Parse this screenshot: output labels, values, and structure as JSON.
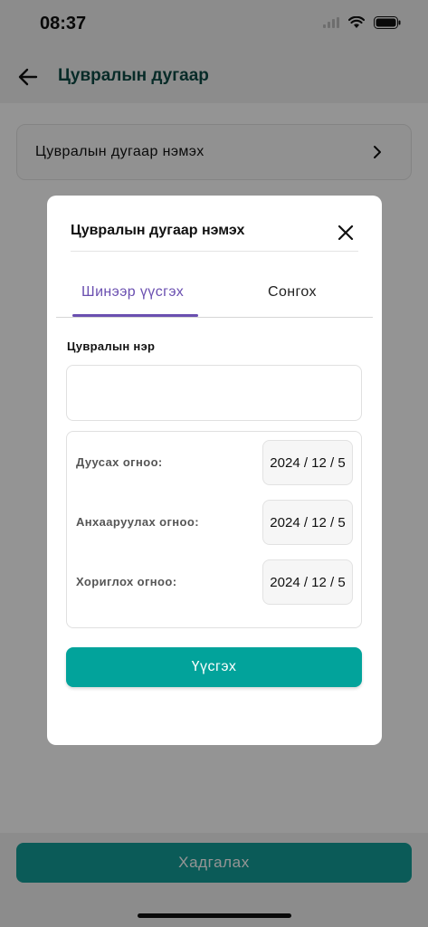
{
  "status_bar": {
    "time": "08:37"
  },
  "app_bar": {
    "title": "Цувралын дугаар",
    "back_icon": "arrow-left-icon"
  },
  "list": {
    "add_row_label": "Цувралын дугаар нэмэх",
    "chevron_icon": "chevron-right-icon"
  },
  "footer": {
    "save_label": "Хадгалах"
  },
  "modal": {
    "title": "Цувралын дугаар нэмэх",
    "close_icon": "close-icon",
    "tabs": [
      {
        "label": "Шинээр үүсгэх",
        "active": true
      },
      {
        "label": "Сонгох",
        "active": false
      }
    ],
    "name_field": {
      "label": "Цувралын нэр",
      "value": "",
      "placeholder": ""
    },
    "dates": [
      {
        "label": "Дуусах огноо:",
        "value": "2024 / 12 / 5"
      },
      {
        "label": "Анхааруулах огноо:",
        "value": "2024 / 12 / 5"
      },
      {
        "label": "Хориглох огноо:",
        "value": "2024 / 12 / 5"
      }
    ],
    "create_label": "Үүсгэх"
  },
  "colors": {
    "accent_purple": "#6a4fb0",
    "primary_teal": "#02a39b",
    "title_green": "#0d4b45"
  }
}
